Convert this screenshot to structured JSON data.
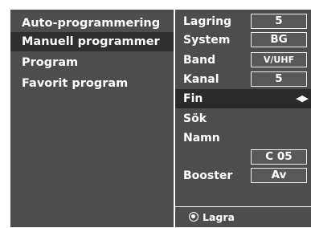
{
  "left_menu": {
    "items": [
      {
        "label": "Auto-programmering"
      },
      {
        "label": "Manuell programmer",
        "selected": true
      },
      {
        "label": "Program"
      },
      {
        "label": "Favorit program"
      }
    ]
  },
  "settings": {
    "lagring": {
      "label": "Lagring",
      "value": "5"
    },
    "system": {
      "label": "System",
      "value": "BG"
    },
    "band": {
      "label": "Band",
      "value": "V/UHF"
    },
    "kanal": {
      "label": "Kanal",
      "value": "5"
    },
    "fin": {
      "label": "Fin",
      "arrows": "◀▶"
    },
    "sok": {
      "label": "Sök"
    },
    "namn": {
      "label": "Namn",
      "value": "C 05"
    },
    "booster": {
      "label": "Booster",
      "value": "Av"
    }
  },
  "footer": {
    "label": "Lagra",
    "icon": "radio-button-icon"
  },
  "colors": {
    "panel": "#4d4d4d",
    "highlight": "#2a2a2a",
    "text": "#ffffff"
  }
}
